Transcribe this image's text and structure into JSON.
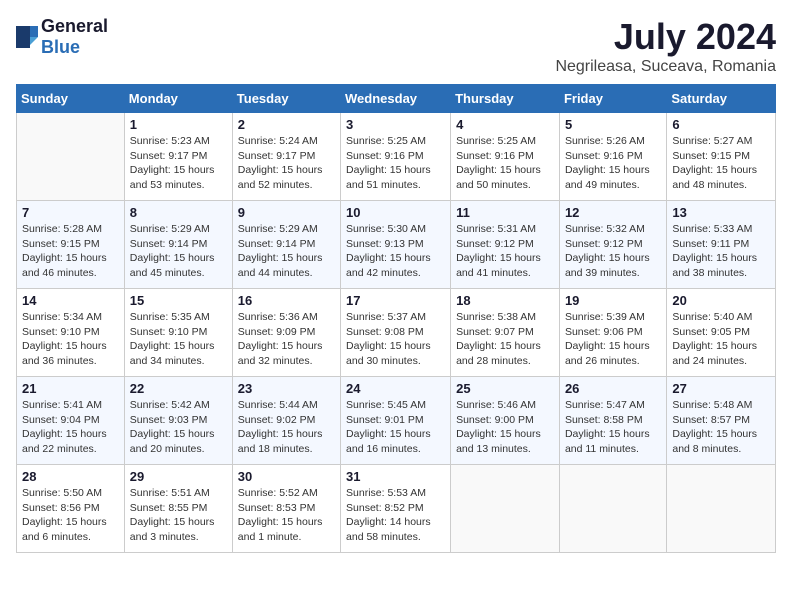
{
  "logo": {
    "general": "General",
    "blue": "Blue"
  },
  "title": "July 2024",
  "location": "Negrileasa, Suceava, Romania",
  "days_header": [
    "Sunday",
    "Monday",
    "Tuesday",
    "Wednesday",
    "Thursday",
    "Friday",
    "Saturday"
  ],
  "weeks": [
    [
      {
        "day": "",
        "empty": true
      },
      {
        "day": "1",
        "sunrise": "Sunrise: 5:23 AM",
        "sunset": "Sunset: 9:17 PM",
        "daylight": "Daylight: 15 hours and 53 minutes."
      },
      {
        "day": "2",
        "sunrise": "Sunrise: 5:24 AM",
        "sunset": "Sunset: 9:17 PM",
        "daylight": "Daylight: 15 hours and 52 minutes."
      },
      {
        "day": "3",
        "sunrise": "Sunrise: 5:25 AM",
        "sunset": "Sunset: 9:16 PM",
        "daylight": "Daylight: 15 hours and 51 minutes."
      },
      {
        "day": "4",
        "sunrise": "Sunrise: 5:25 AM",
        "sunset": "Sunset: 9:16 PM",
        "daylight": "Daylight: 15 hours and 50 minutes."
      },
      {
        "day": "5",
        "sunrise": "Sunrise: 5:26 AM",
        "sunset": "Sunset: 9:16 PM",
        "daylight": "Daylight: 15 hours and 49 minutes."
      },
      {
        "day": "6",
        "sunrise": "Sunrise: 5:27 AM",
        "sunset": "Sunset: 9:15 PM",
        "daylight": "Daylight: 15 hours and 48 minutes."
      }
    ],
    [
      {
        "day": "7",
        "sunrise": "Sunrise: 5:28 AM",
        "sunset": "Sunset: 9:15 PM",
        "daylight": "Daylight: 15 hours and 46 minutes."
      },
      {
        "day": "8",
        "sunrise": "Sunrise: 5:29 AM",
        "sunset": "Sunset: 9:14 PM",
        "daylight": "Daylight: 15 hours and 45 minutes."
      },
      {
        "day": "9",
        "sunrise": "Sunrise: 5:29 AM",
        "sunset": "Sunset: 9:14 PM",
        "daylight": "Daylight: 15 hours and 44 minutes."
      },
      {
        "day": "10",
        "sunrise": "Sunrise: 5:30 AM",
        "sunset": "Sunset: 9:13 PM",
        "daylight": "Daylight: 15 hours and 42 minutes."
      },
      {
        "day": "11",
        "sunrise": "Sunrise: 5:31 AM",
        "sunset": "Sunset: 9:12 PM",
        "daylight": "Daylight: 15 hours and 41 minutes."
      },
      {
        "day": "12",
        "sunrise": "Sunrise: 5:32 AM",
        "sunset": "Sunset: 9:12 PM",
        "daylight": "Daylight: 15 hours and 39 minutes."
      },
      {
        "day": "13",
        "sunrise": "Sunrise: 5:33 AM",
        "sunset": "Sunset: 9:11 PM",
        "daylight": "Daylight: 15 hours and 38 minutes."
      }
    ],
    [
      {
        "day": "14",
        "sunrise": "Sunrise: 5:34 AM",
        "sunset": "Sunset: 9:10 PM",
        "daylight": "Daylight: 15 hours and 36 minutes."
      },
      {
        "day": "15",
        "sunrise": "Sunrise: 5:35 AM",
        "sunset": "Sunset: 9:10 PM",
        "daylight": "Daylight: 15 hours and 34 minutes."
      },
      {
        "day": "16",
        "sunrise": "Sunrise: 5:36 AM",
        "sunset": "Sunset: 9:09 PM",
        "daylight": "Daylight: 15 hours and 32 minutes."
      },
      {
        "day": "17",
        "sunrise": "Sunrise: 5:37 AM",
        "sunset": "Sunset: 9:08 PM",
        "daylight": "Daylight: 15 hours and 30 minutes."
      },
      {
        "day": "18",
        "sunrise": "Sunrise: 5:38 AM",
        "sunset": "Sunset: 9:07 PM",
        "daylight": "Daylight: 15 hours and 28 minutes."
      },
      {
        "day": "19",
        "sunrise": "Sunrise: 5:39 AM",
        "sunset": "Sunset: 9:06 PM",
        "daylight": "Daylight: 15 hours and 26 minutes."
      },
      {
        "day": "20",
        "sunrise": "Sunrise: 5:40 AM",
        "sunset": "Sunset: 9:05 PM",
        "daylight": "Daylight: 15 hours and 24 minutes."
      }
    ],
    [
      {
        "day": "21",
        "sunrise": "Sunrise: 5:41 AM",
        "sunset": "Sunset: 9:04 PM",
        "daylight": "Daylight: 15 hours and 22 minutes."
      },
      {
        "day": "22",
        "sunrise": "Sunrise: 5:42 AM",
        "sunset": "Sunset: 9:03 PM",
        "daylight": "Daylight: 15 hours and 20 minutes."
      },
      {
        "day": "23",
        "sunrise": "Sunrise: 5:44 AM",
        "sunset": "Sunset: 9:02 PM",
        "daylight": "Daylight: 15 hours and 18 minutes."
      },
      {
        "day": "24",
        "sunrise": "Sunrise: 5:45 AM",
        "sunset": "Sunset: 9:01 PM",
        "daylight": "Daylight: 15 hours and 16 minutes."
      },
      {
        "day": "25",
        "sunrise": "Sunrise: 5:46 AM",
        "sunset": "Sunset: 9:00 PM",
        "daylight": "Daylight: 15 hours and 13 minutes."
      },
      {
        "day": "26",
        "sunrise": "Sunrise: 5:47 AM",
        "sunset": "Sunset: 8:58 PM",
        "daylight": "Daylight: 15 hours and 11 minutes."
      },
      {
        "day": "27",
        "sunrise": "Sunrise: 5:48 AM",
        "sunset": "Sunset: 8:57 PM",
        "daylight": "Daylight: 15 hours and 8 minutes."
      }
    ],
    [
      {
        "day": "28",
        "sunrise": "Sunrise: 5:50 AM",
        "sunset": "Sunset: 8:56 PM",
        "daylight": "Daylight: 15 hours and 6 minutes."
      },
      {
        "day": "29",
        "sunrise": "Sunrise: 5:51 AM",
        "sunset": "Sunset: 8:55 PM",
        "daylight": "Daylight: 15 hours and 3 minutes."
      },
      {
        "day": "30",
        "sunrise": "Sunrise: 5:52 AM",
        "sunset": "Sunset: 8:53 PM",
        "daylight": "Daylight: 15 hours and 1 minute."
      },
      {
        "day": "31",
        "sunrise": "Sunrise: 5:53 AM",
        "sunset": "Sunset: 8:52 PM",
        "daylight": "Daylight: 14 hours and 58 minutes."
      },
      {
        "day": "",
        "empty": true
      },
      {
        "day": "",
        "empty": true
      },
      {
        "day": "",
        "empty": true
      }
    ]
  ]
}
